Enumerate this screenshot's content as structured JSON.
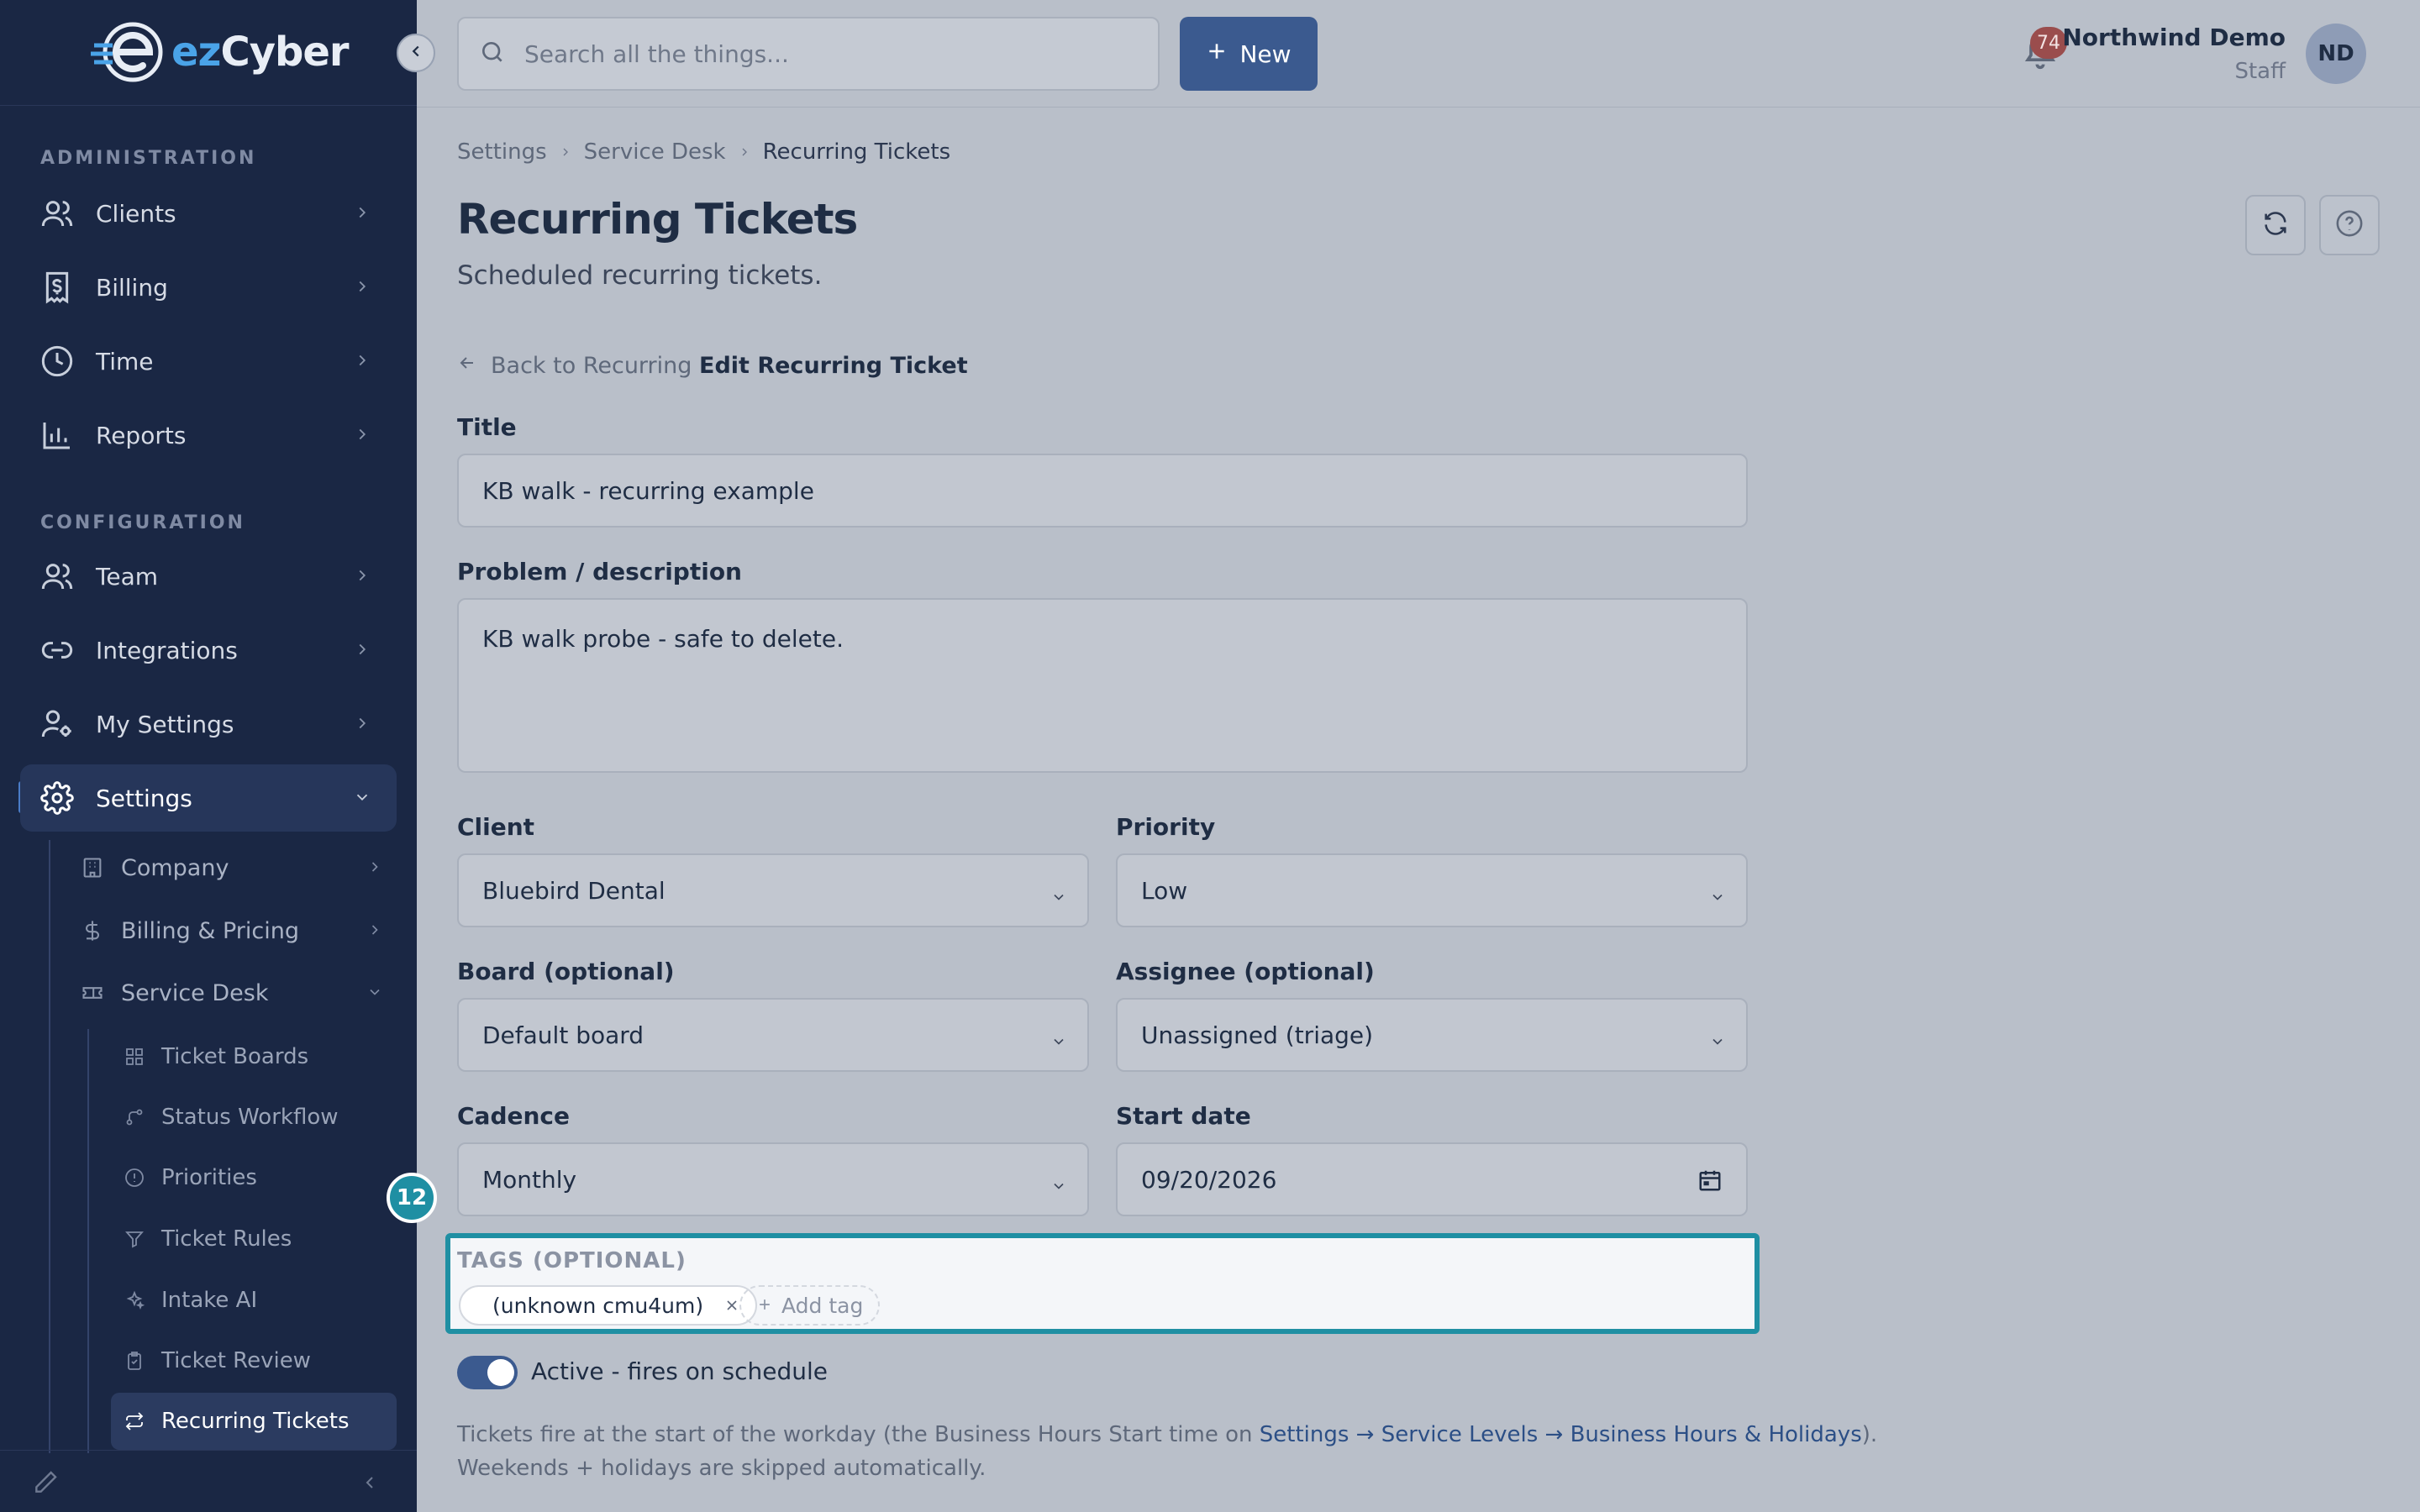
{
  "brand": {
    "logo_ez": "ez",
    "logo_rest": "Cyber"
  },
  "sidebar": {
    "sections": {
      "administration": "ADMINISTRATION",
      "configuration": "CONFIGURATION"
    },
    "items": [
      {
        "label": "Clients",
        "icon": "users-icon"
      },
      {
        "label": "Billing",
        "icon": "receipt-icon"
      },
      {
        "label": "Time",
        "icon": "clock-icon"
      },
      {
        "label": "Reports",
        "icon": "bar-chart-icon"
      },
      {
        "label": "Team",
        "icon": "team-icon"
      },
      {
        "label": "Integrations",
        "icon": "link-icon"
      },
      {
        "label": "My Settings",
        "icon": "user-gear-icon"
      },
      {
        "label": "Settings",
        "icon": "gear-icon",
        "active": true
      }
    ],
    "settings_sub": [
      {
        "label": "Company",
        "icon": "building-icon"
      },
      {
        "label": "Billing & Pricing",
        "icon": "dollar-icon"
      },
      {
        "label": "Service Desk",
        "icon": "ticket-icon"
      }
    ],
    "service_desk_sub": [
      {
        "label": "Ticket Boards",
        "icon": "grid-icon"
      },
      {
        "label": "Status Workflow",
        "icon": "workflow-icon"
      },
      {
        "label": "Priorities",
        "icon": "alert-circle-icon"
      },
      {
        "label": "Ticket Rules",
        "icon": "filter-icon"
      },
      {
        "label": "Intake AI",
        "icon": "sparkle-icon"
      },
      {
        "label": "Ticket Review",
        "icon": "clipboard-icon"
      },
      {
        "label": "Recurring Tickets",
        "icon": "repeat-icon",
        "active": true
      }
    ]
  },
  "topbar": {
    "search_placeholder": "Search all the things...",
    "new_label": "New",
    "notifications_count": "74",
    "user_name": "Northwind Demo",
    "user_role": "Staff",
    "avatar_initials": "ND"
  },
  "breadcrumb": [
    "Settings",
    "Service Desk",
    "Recurring Tickets"
  ],
  "page": {
    "title": "Recurring Tickets",
    "subtitle": "Scheduled recurring tickets.",
    "back_label": "Back to Recurring",
    "edit_title": "Edit Recurring Ticket"
  },
  "form": {
    "title_label": "Title",
    "title_value": "KB walk - recurring example",
    "description_label": "Problem / description",
    "description_value": "KB walk probe - safe to delete.",
    "client_label": "Client",
    "client_value": "Bluebird Dental",
    "priority_label": "Priority",
    "priority_value": "Low",
    "board_label": "Board (optional)",
    "board_value": "Default board",
    "assignee_label": "Assignee (optional)",
    "assignee_value": "Unassigned (triage)",
    "cadence_label": "Cadence",
    "cadence_value": "Monthly",
    "start_label": "Start date",
    "start_value": "09/20/2026",
    "tags_label": "TAGS (OPTIONAL)",
    "tags": [
      "(unknown cmu4um)"
    ],
    "add_tag_label": "Add tag",
    "active_label": "Active - fires on schedule",
    "active_on": true,
    "note_prefix": "Tickets fire at the start of the workday (the Business Hours Start time on ",
    "note_link": "Settings → Service Levels → Business Hours & Holidays",
    "note_suffix": ").",
    "note_line2": "Weekends + holidays are skipped automatically."
  },
  "annotation": {
    "marker": "12"
  },
  "colors": {
    "sidebar_bg": "#1a2744",
    "accent": "#3b5a8f",
    "highlight": "#1f8fa3",
    "badge": "#9a4d4d"
  }
}
